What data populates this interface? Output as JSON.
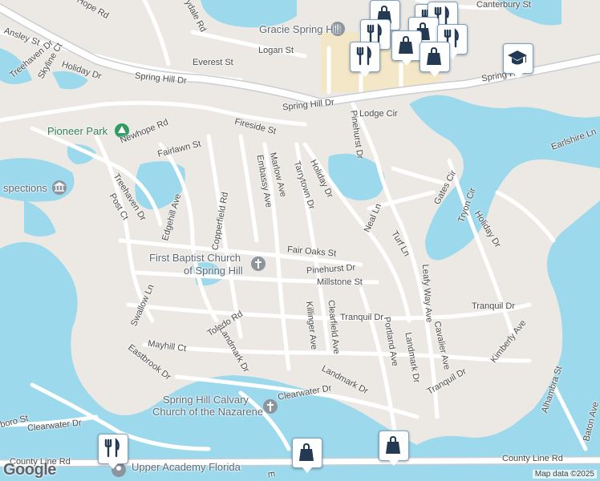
{
  "map": {
    "attribution": "Map data ©2025",
    "logo": "Google",
    "colors": {
      "land": "#ece9e4",
      "water": "#9cd9ec",
      "road": "#ffffff",
      "major_road": "#d6dadd",
      "park": "#c6e8ce",
      "commercial": "#f3e7c8"
    },
    "places": [
      {
        "text": "Gracie Spring Hill",
        "kind": "poi"
      },
      {
        "text": "Pioneer Park",
        "kind": "park"
      },
      {
        "text": "spections",
        "kind": "poi"
      },
      {
        "text": "First Baptist Church",
        "kind": "poi"
      },
      {
        "text": "of Spring Hill",
        "kind": "poi"
      },
      {
        "text": "Spring Hill Calvary",
        "kind": "poi"
      },
      {
        "text": "Church of the Nazarene",
        "kind": "poi"
      },
      {
        "text": "Upper Academy Florida",
        "kind": "poi"
      }
    ],
    "streets": [
      "Canterbury St",
      "Logan St",
      "Everest St",
      "Spring Hill Dr",
      "Spring Hill Dr",
      "Spring Hill Dr",
      "Ansley St",
      "Treehaven Dr",
      "Skyline Ct",
      "Holiday Dr",
      "Newhope Rd",
      "Fairlawn St",
      "Fireside St",
      "Lodge Cir",
      "Pinehurst Dr",
      "Embassy Ave",
      "Marlow Ave",
      "Tarrytown Dr",
      "Holiday Dr",
      "Treehaven Dr",
      "Post Ct",
      "Edgehill Ave",
      "Copperfield Rd",
      "Fair Oaks St",
      "Pinehurst Dr",
      "Millstone St",
      "Neal Ln",
      "Turf Ln",
      "Gates Cir",
      "Tryon Cir",
      "Holiday Dr",
      "Earlshire Ln",
      "Leafy Way Ave",
      "Swallow Ln",
      "Mayhill Ct",
      "Toledo Rd",
      "Landmark Dr",
      "Eastbrook Dr",
      "Killinger Ave",
      "Clearfield Ave",
      "Tranquil Dr",
      "Portland Ave",
      "Landmark Dr",
      "Tranquil Dr",
      "Cavalier Ave",
      "Kimberly Ave",
      "Tranquil Dr",
      "Alhambra St",
      "Landmark Dr",
      "Clearwater Dr",
      "Clearwater Dr",
      "County Line Rd",
      "County Line Rd",
      "Baton Ave",
      "Hope Rd",
      "ydale Rd",
      "boro St",
      "E"
    ],
    "markers": [
      "shop",
      "restaurant",
      "restaurant",
      "shop",
      "restaurant",
      "shop",
      "restaurant",
      "restaurant",
      "shop",
      "education",
      "restaurant",
      "shop",
      "shop"
    ]
  }
}
